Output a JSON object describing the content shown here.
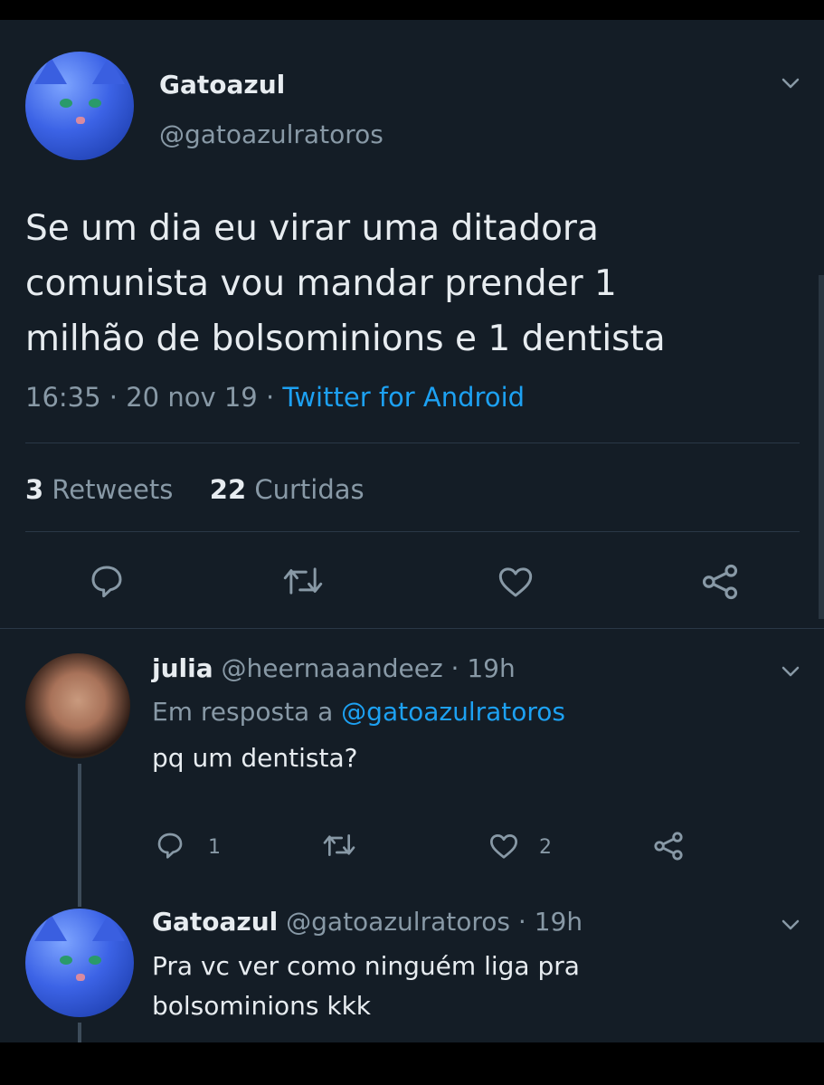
{
  "main_tweet": {
    "name": "Gatoazul",
    "handle": "@gatoazulratoros",
    "text_line1": "Se um dia eu virar uma ditadora",
    "text_line2": "comunista vou mandar prender 1",
    "text_line3": "milhão de bolsominions e 1 dentista",
    "time": "16:35",
    "date": "20 nov 19",
    "source": "Twitter for Android",
    "retweets_count": "3",
    "retweets_label": "Retweets",
    "likes_count": "22",
    "likes_label": "Curtidas"
  },
  "reply1": {
    "name": "julia",
    "handle": "@heernaaandeez",
    "time": "19h",
    "reply_prefix": "Em resposta a",
    "reply_mention": "@gatoazulratoros",
    "text": "pq um dentista?",
    "reply_count": "1",
    "like_count": "2"
  },
  "reply2": {
    "name": "Gatoazul",
    "handle": "@gatoazulratoros",
    "time": "19h",
    "text_line1": "Pra vc ver como ninguém liga pra",
    "text_line2": "bolsominions kkk"
  },
  "colors": {
    "background": "#141d26",
    "text": "#e7ecf0",
    "muted": "#8899a6",
    "link": "#1da1f2"
  },
  "icons": [
    "chevron-down-icon",
    "reply-icon",
    "retweet-icon",
    "heart-icon",
    "share-icon"
  ]
}
